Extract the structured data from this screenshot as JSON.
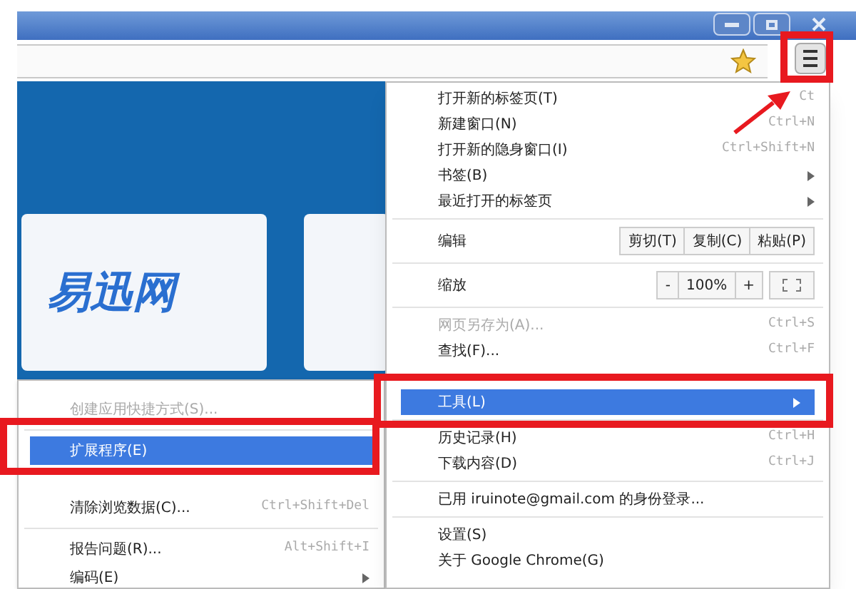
{
  "page": {
    "logo": "易迅网"
  },
  "main_menu": {
    "items": [
      {
        "kind": "item",
        "label": "打开新的标签页(T)",
        "shortcut": "Ct",
        "submenu": false,
        "disabled": false,
        "selected": false
      },
      {
        "kind": "item",
        "label": "新建窗口(N)",
        "shortcut": "Ctrl+N",
        "submenu": false,
        "disabled": false,
        "selected": false
      },
      {
        "kind": "item",
        "label": "打开新的隐身窗口(I)",
        "shortcut": "Ctrl+Shift+N",
        "submenu": false,
        "disabled": false,
        "selected": false
      },
      {
        "kind": "item",
        "label": "书签(B)",
        "submenu": true,
        "disabled": false,
        "selected": false
      },
      {
        "kind": "item",
        "label": "最近打开的标签页",
        "submenu": true,
        "disabled": false,
        "selected": false
      },
      {
        "kind": "separator"
      },
      {
        "kind": "edit",
        "label": "编辑",
        "buttons": [
          "剪切(T)",
          "复制(C)",
          "粘贴(P)"
        ]
      },
      {
        "kind": "separator"
      },
      {
        "kind": "zoom",
        "label": "缩放",
        "buttons": [
          "-",
          "100%",
          "+"
        ]
      },
      {
        "kind": "separator"
      },
      {
        "kind": "item",
        "label": "网页另存为(A)...",
        "shortcut": "Ctrl+S",
        "submenu": false,
        "disabled": true,
        "selected": false
      },
      {
        "kind": "item",
        "label": "查找(F)...",
        "shortcut": "Ctrl+F",
        "submenu": false,
        "disabled": false,
        "selected": false
      },
      {
        "kind": "obscured"
      },
      {
        "kind": "item",
        "label": "工具(L)",
        "submenu": true,
        "disabled": false,
        "selected": true
      },
      {
        "kind": "separator"
      },
      {
        "kind": "item",
        "label": "历史记录(H)",
        "shortcut": "Ctrl+H",
        "submenu": false,
        "disabled": false,
        "selected": false
      },
      {
        "kind": "item",
        "label": "下载内容(D)",
        "shortcut": "Ctrl+J",
        "submenu": false,
        "disabled": false,
        "selected": false
      },
      {
        "kind": "separator"
      },
      {
        "kind": "item",
        "label": "已用 iruinote@gmail.com 的身份登录...",
        "submenu": false,
        "disabled": false,
        "selected": false
      },
      {
        "kind": "separator"
      },
      {
        "kind": "item",
        "label": "设置(S)",
        "submenu": false,
        "disabled": false,
        "selected": false
      },
      {
        "kind": "item",
        "label": "关于 Google Chrome(G)",
        "submenu": false,
        "disabled": false,
        "selected": false
      }
    ]
  },
  "tools_submenu": {
    "items": [
      {
        "kind": "item",
        "label": "创建应用快捷方式(S)...",
        "submenu": false,
        "disabled": true,
        "selected": false
      },
      {
        "kind": "separator"
      },
      {
        "kind": "item",
        "label": "扩展程序(E)",
        "submenu": false,
        "disabled": false,
        "selected": true
      },
      {
        "kind": "obscured"
      },
      {
        "kind": "item",
        "label": "清除浏览数据(C)...",
        "shortcut": "Ctrl+Shift+Del",
        "submenu": false,
        "disabled": false,
        "selected": false
      },
      {
        "kind": "separator"
      },
      {
        "kind": "item",
        "label": "报告问题(R)...",
        "shortcut": "Alt+Shift+I",
        "submenu": false,
        "disabled": false,
        "selected": false
      },
      {
        "kind": "item",
        "label": "编码(E)",
        "submenu": true,
        "disabled": false,
        "selected": false
      }
    ]
  }
}
